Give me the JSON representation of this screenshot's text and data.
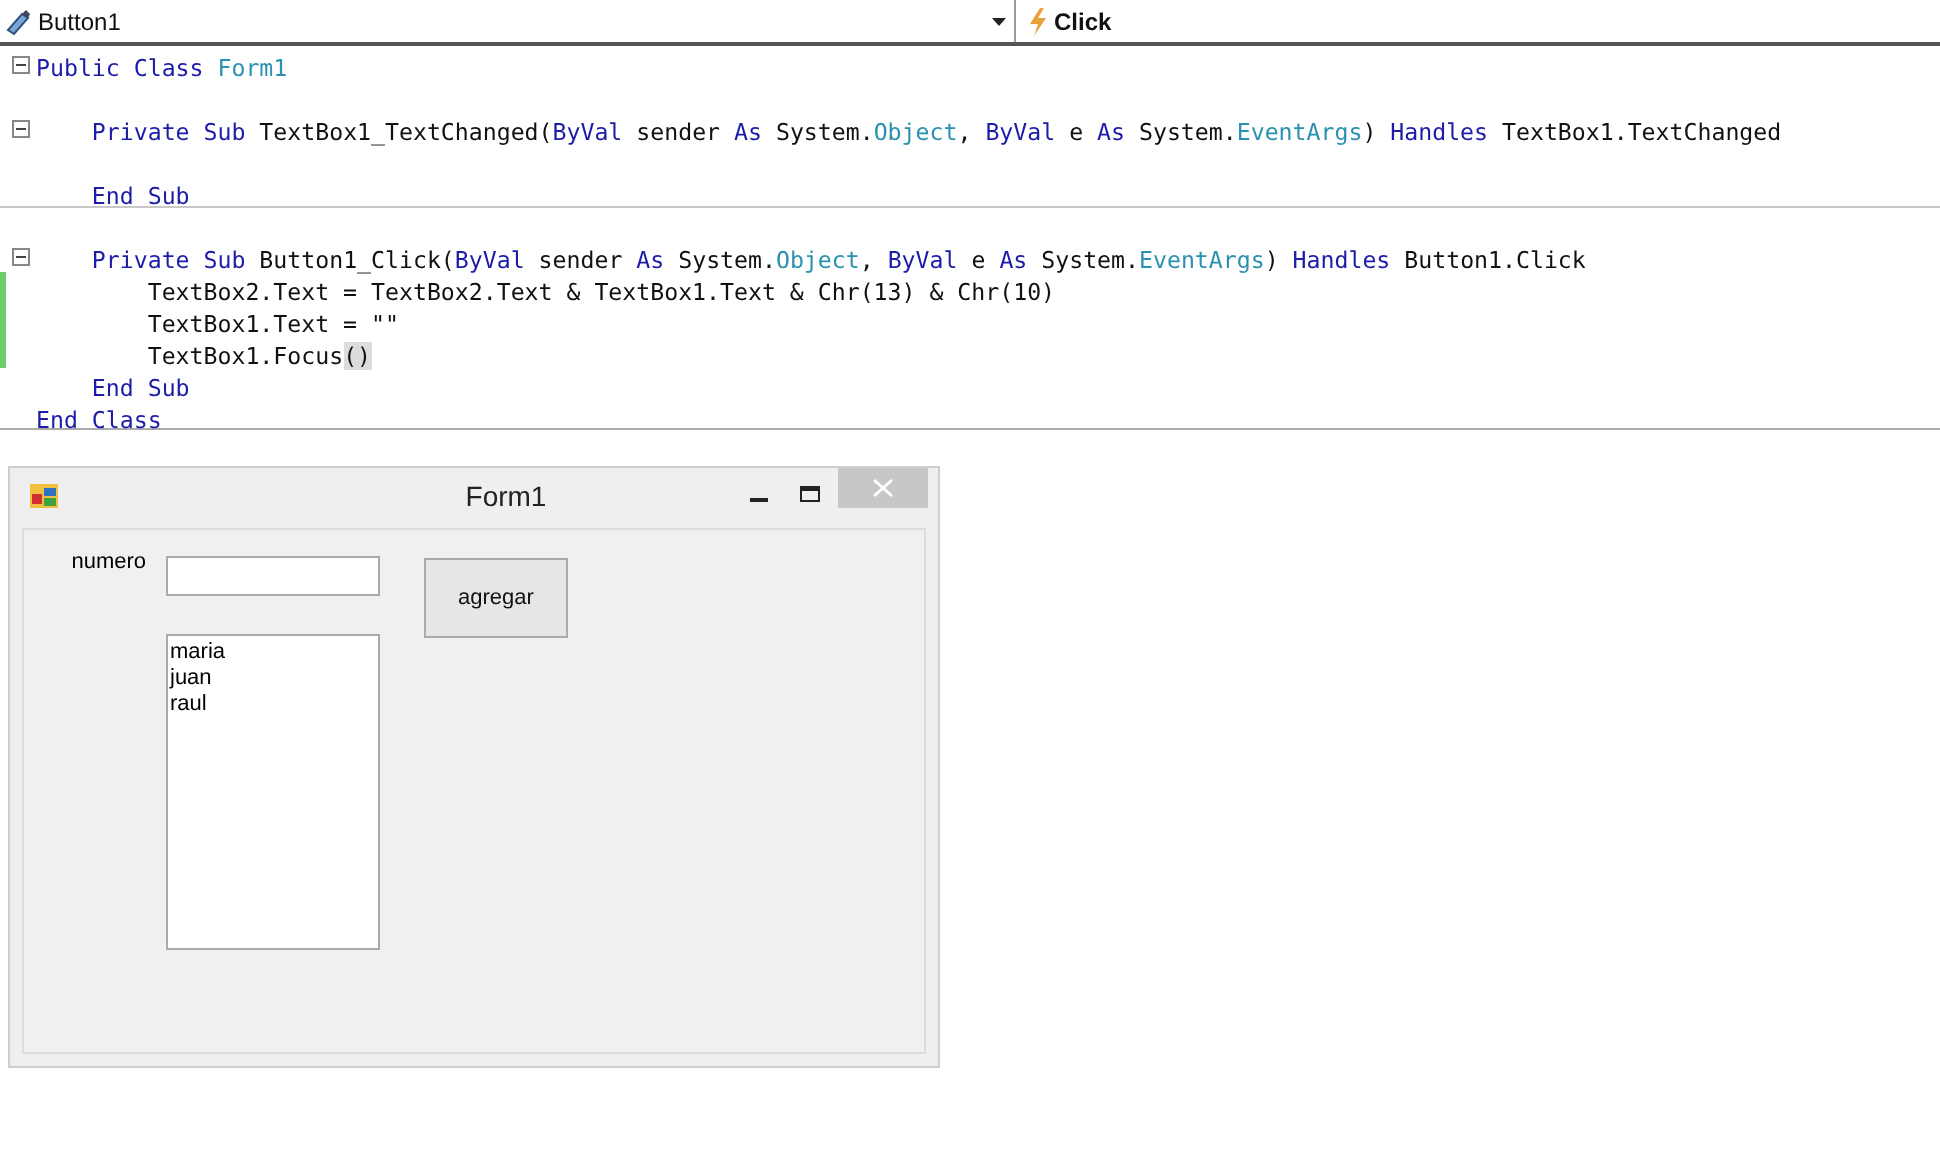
{
  "navigation_bar": {
    "object": "Button1",
    "event": "Click"
  },
  "code_lines": [
    {
      "kind": "code",
      "fold": true,
      "tokens": [
        {
          "kind": "keyword",
          "text": "Public Class"
        },
        {
          "kind": "type",
          "text": " Form1"
        }
      ]
    },
    {
      "kind": "blank"
    },
    {
      "kind": "code",
      "fold": true,
      "tokens": [
        {
          "kind": "keyword",
          "text": "    Private Sub"
        },
        {
          "kind": "plain",
          "text": " TextBox1_TextChanged("
        },
        {
          "kind": "keyword",
          "text": "ByVal"
        },
        {
          "kind": "plain",
          "text": " sender "
        },
        {
          "kind": "keyword",
          "text": "As"
        },
        {
          "kind": "plain",
          "text": " System."
        },
        {
          "kind": "type",
          "text": "Object"
        },
        {
          "kind": "plain",
          "text": ", "
        },
        {
          "kind": "keyword",
          "text": "ByVal"
        },
        {
          "kind": "plain",
          "text": " e "
        },
        {
          "kind": "keyword",
          "text": "As"
        },
        {
          "kind": "plain",
          "text": " System."
        },
        {
          "kind": "type",
          "text": "EventArgs"
        },
        {
          "kind": "plain",
          "text": ") "
        },
        {
          "kind": "keyword",
          "text": "Handles"
        },
        {
          "kind": "plain",
          "text": " TextBox1.TextChanged"
        }
      ]
    },
    {
      "kind": "blank"
    },
    {
      "kind": "code",
      "separator_after": true,
      "tokens": [
        {
          "kind": "keyword",
          "text": "    End Sub"
        }
      ]
    },
    {
      "kind": "blank"
    },
    {
      "kind": "code",
      "fold": true,
      "tokens": [
        {
          "kind": "keyword",
          "text": "    Private Sub"
        },
        {
          "kind": "plain",
          "text": " Button1_Click("
        },
        {
          "kind": "keyword",
          "text": "ByVal"
        },
        {
          "kind": "plain",
          "text": " sender "
        },
        {
          "kind": "keyword",
          "text": "As"
        },
        {
          "kind": "plain",
          "text": " System."
        },
        {
          "kind": "type",
          "text": "Object"
        },
        {
          "kind": "plain",
          "text": ", "
        },
        {
          "kind": "keyword",
          "text": "ByVal"
        },
        {
          "kind": "plain",
          "text": " e "
        },
        {
          "kind": "keyword",
          "text": "As"
        },
        {
          "kind": "plain",
          "text": " System."
        },
        {
          "kind": "type",
          "text": "EventArgs"
        },
        {
          "kind": "plain",
          "text": ") "
        },
        {
          "kind": "keyword",
          "text": "Handles"
        },
        {
          "kind": "plain",
          "text": " Button1.Click"
        }
      ]
    },
    {
      "kind": "code",
      "changed": true,
      "tokens": [
        {
          "kind": "plain",
          "text": "        TextBox2.Text = TextBox2.Text & TextBox1.Text & Chr(13) & Chr(10)"
        }
      ]
    },
    {
      "kind": "code",
      "changed": true,
      "tokens": [
        {
          "kind": "plain",
          "text": "        TextBox1.Text = \"\""
        }
      ]
    },
    {
      "kind": "code",
      "changed": true,
      "tokens": [
        {
          "kind": "plain",
          "text": "        TextBox1.Focus"
        },
        {
          "kind": "match",
          "text": "("
        },
        {
          "kind": "match",
          "text": ")"
        }
      ]
    },
    {
      "kind": "code",
      "tokens": [
        {
          "kind": "keyword",
          "text": "    End Sub"
        }
      ]
    },
    {
      "kind": "code",
      "tokens": [
        {
          "kind": "keyword",
          "text": "End Class"
        }
      ]
    }
  ],
  "form": {
    "title": "Form1",
    "label": "numero",
    "button": "agregar",
    "list_items": [
      "maria",
      "juan",
      "raul"
    ]
  }
}
